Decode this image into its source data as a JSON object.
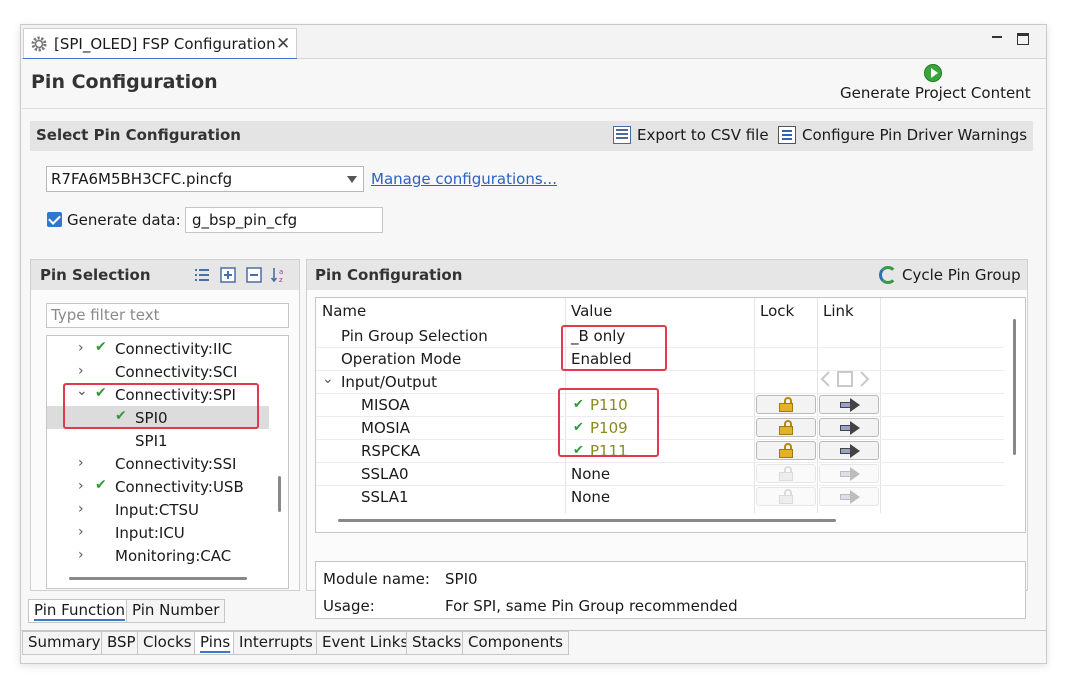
{
  "editor_tab": {
    "title": "[SPI_OLED] FSP Configuration",
    "close_glyph": "✕",
    "icon": "gear-icon"
  },
  "page": {
    "title": "Pin Configuration",
    "generate_label": "Generate Project Content",
    "generate_icon": "play-green-icon"
  },
  "select_config": {
    "title": "Select Pin Configuration",
    "export_csv_label": "Export to CSV file",
    "configure_warnings_label": "Configure Pin Driver Warnings",
    "pincfg_value": "R7FA6M5BH3CFC.pincfg",
    "manage_link": "Manage configurations...",
    "generate_data_label": "Generate data:",
    "generate_data_checked": true,
    "generate_data_value": "g_bsp_pin_cfg"
  },
  "pin_selection": {
    "title": "Pin Selection",
    "filter_placeholder": "Type filter text",
    "tree": [
      {
        "label": "Connectivity:IIC",
        "expand": "›",
        "checked": true
      },
      {
        "label": "Connectivity:SCI",
        "expand": "›",
        "checked": false
      },
      {
        "label": "Connectivity:SPI",
        "expand": "⌄",
        "checked": true
      },
      {
        "label": "SPI0",
        "expand": "",
        "checked": true,
        "selected": true
      },
      {
        "label": "SPI1",
        "expand": "",
        "checked": false
      },
      {
        "label": "Connectivity:SSI",
        "expand": "›",
        "checked": false
      },
      {
        "label": "Connectivity:USB",
        "expand": "›",
        "checked": true
      },
      {
        "label": "Input:CTSU",
        "expand": "›",
        "checked": false
      },
      {
        "label": "Input:ICU",
        "expand": "›",
        "checked": false
      },
      {
        "label": "Monitoring:CAC",
        "expand": "›",
        "checked": false
      }
    ]
  },
  "pin_config": {
    "title": "Pin Configuration",
    "cycle_label": "Cycle Pin Group",
    "columns": {
      "name": "Name",
      "value": "Value",
      "lock": "Lock",
      "link": "Link"
    },
    "rows": [
      {
        "name": "Pin Group Selection",
        "value": "_B only"
      },
      {
        "name": "Operation Mode",
        "value": "Enabled"
      },
      {
        "name": "Input/Output",
        "value": "",
        "expand": "⌄"
      },
      {
        "name": "MISOA",
        "value": "P110",
        "checked": true
      },
      {
        "name": "MOSIA",
        "value": "P109",
        "checked": true
      },
      {
        "name": "RSPCKA",
        "value": "P111",
        "checked": true
      },
      {
        "name": "SSLA0",
        "value": "None"
      },
      {
        "name": "SSLA1",
        "value": "None"
      }
    ],
    "check_glyph": "✔",
    "info": {
      "module_label": "Module name:",
      "module_value": "SPI0",
      "usage_label": "Usage:",
      "usage_value": "For SPI, same Pin Group recommended"
    }
  },
  "sub_tabs": [
    "Pin Function",
    "Pin Number"
  ],
  "bottom_tabs": [
    "Summary",
    "BSP",
    "Clocks",
    "Pins",
    "Interrupts",
    "Event Links",
    "Stacks",
    "Components"
  ],
  "colors": {
    "highlight": "#e23a4a",
    "check": "#2f9a3a",
    "pin_value": "#8a8a20",
    "link": "#2b62c4"
  }
}
